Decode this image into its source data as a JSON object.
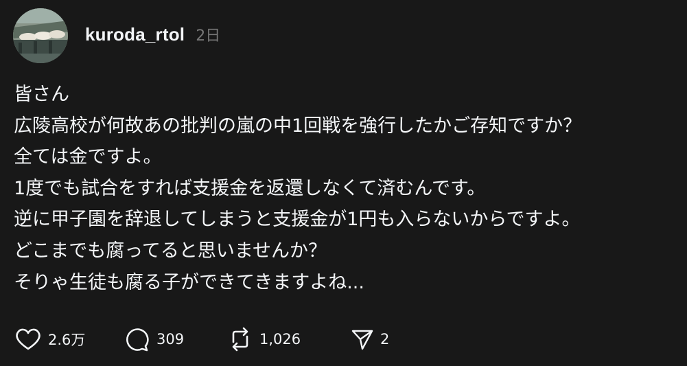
{
  "post": {
    "username": "kuroda_rtol",
    "timestamp": "2日",
    "body_lines": [
      "皆さん",
      "広陵高校が何故あの批判の嵐の中1回戦を強行したかご存知ですか？",
      "全ては金ですよ。",
      "1度でも試合をすれば支援金を返還しなくて済むんです。",
      "逆に甲子園を辞退してしまうと支援金が1円も入らないからですよ。",
      "どこまでも腐ってると思いませんか？",
      "そりゃ生徒も腐る子ができてきますよね..."
    ]
  },
  "actions": {
    "like": {
      "icon": "heart-icon",
      "count": "2.6万"
    },
    "reply": {
      "icon": "speech-bubble-icon",
      "count": "309"
    },
    "repost": {
      "icon": "repost-icon",
      "count": "1,026"
    },
    "share": {
      "icon": "send-icon",
      "count": "2"
    }
  },
  "colors": {
    "background": "#181818",
    "text": "#f3f5f7",
    "muted": "#777777"
  }
}
